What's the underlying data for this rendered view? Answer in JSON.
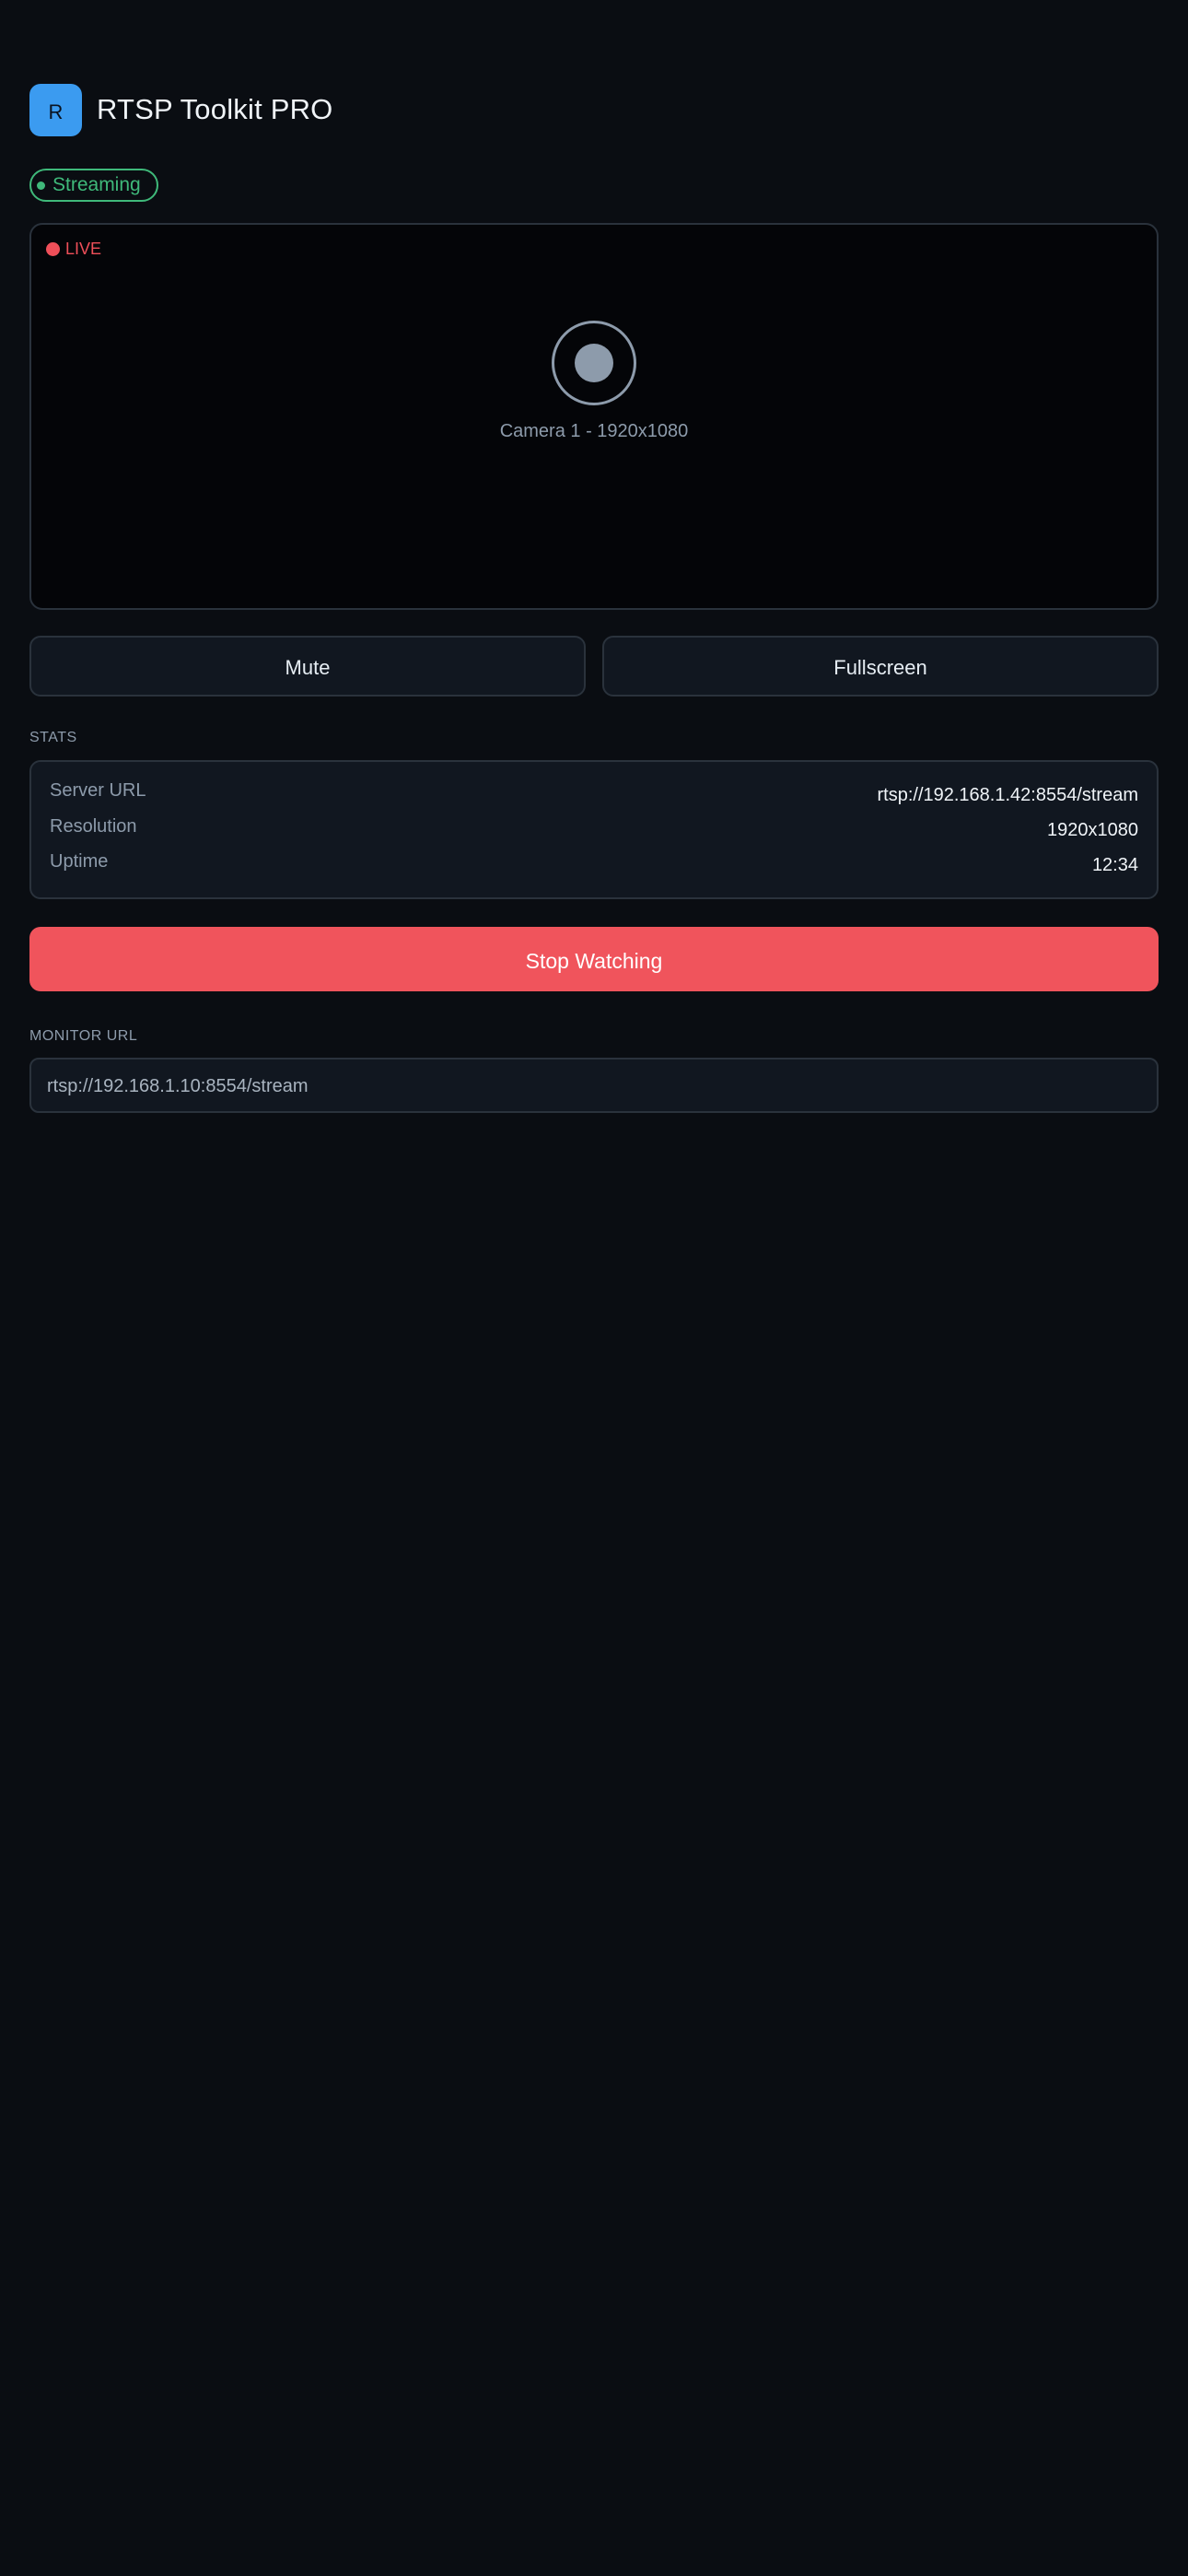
{
  "header": {
    "app_icon_letter": "R",
    "title": "RTSP Toolkit PRO"
  },
  "status": {
    "label": "Streaming",
    "color": "#3fb97a"
  },
  "video": {
    "live_label": "LIVE",
    "live_color": "#ef4f59",
    "camera_caption": "Camera 1 - 1920x1080",
    "placeholder_icon": "camera-placeholder-icon"
  },
  "controls": {
    "mute_label": "Mute",
    "fullscreen_label": "Fullscreen"
  },
  "stats": {
    "section_label": "STATS",
    "rows": [
      {
        "label": "Server URL",
        "value": "rtsp://192.168.1.42:8554/stream"
      },
      {
        "label": "Resolution",
        "value": "1920x1080"
      },
      {
        "label": "Uptime",
        "value": "12:34"
      }
    ]
  },
  "actions": {
    "stop_label": "Stop Watching",
    "stop_color": "#f0545c"
  },
  "monitor": {
    "section_label": "MONITOR URL",
    "url_value": "rtsp://192.168.1.10:8554/stream"
  },
  "colors": {
    "background": "#0a0d12",
    "accent": "#3b9bf0"
  }
}
